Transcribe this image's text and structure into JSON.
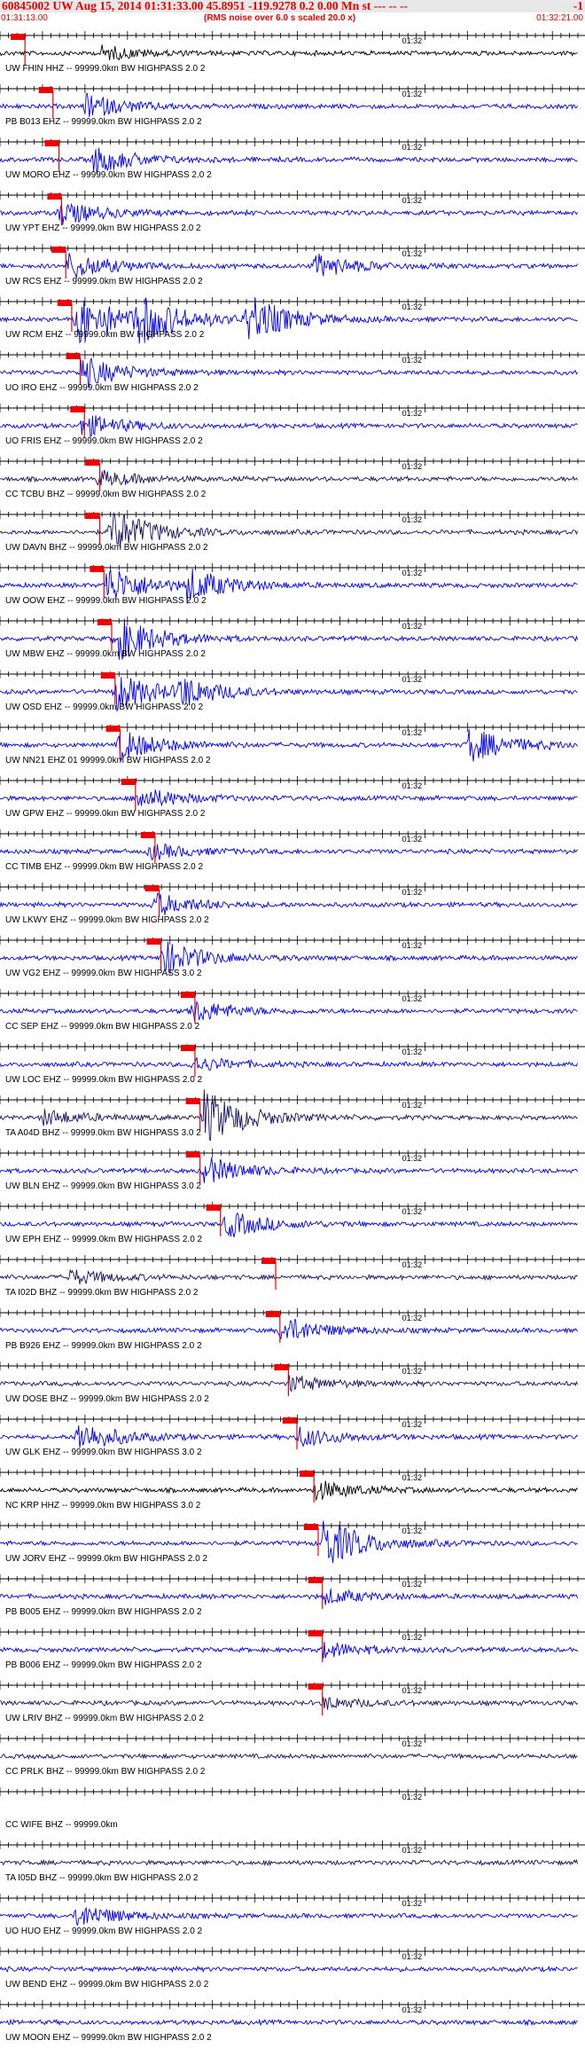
{
  "header": {
    "title": "60845002 UW Aug 15, 2014 01:31:33.00   45.8951 -119.9278  0.2 0.00 Mn st --- -- --",
    "title_tail": "-1",
    "start_time": "01:31:13.00",
    "end_time": "01:32:21.00",
    "rms_note": "(RMS noise over 6.0 s scaled 20.0 x)"
  },
  "colors": {
    "trace_blue": "#0000ee",
    "trace_navy": "#1a1060",
    "trace_black": "#000000",
    "pick_red": "#ee0000",
    "axis": "#000000"
  },
  "chart_data": {
    "type": "seismogram",
    "x_unit": "time",
    "time_start": "01:31:13.00",
    "time_end": "01:32:21.00",
    "minute_mark_label": "01:32",
    "minute_mark_time": "01:32:00",
    "tick_interval_s": 1,
    "traces": [
      {
        "label": "UW FHIN HHZ -- 99999.0km BW  HIGHPASS  2.0  2",
        "color": "black",
        "pick_s": 2.0,
        "events": [
          {
            "t": 12,
            "amp": 0.35
          }
        ]
      },
      {
        "label": "PB B013 EHZ -- 99999.0km BW  HIGHPASS  2.0  2",
        "color": "blue",
        "pick_s": 5.3,
        "events": [
          {
            "t": 10,
            "amp": 0.6
          }
        ]
      },
      {
        "label": "UW MORO EHZ -- 99999.0km BW  HIGHPASS  2.0  2",
        "color": "blue",
        "pick_s": 6.0,
        "events": [
          {
            "t": 11,
            "amp": 0.7
          }
        ]
      },
      {
        "label": "UW YPT EHZ -- 99999.0km BW  HIGHPASS  2.0  2",
        "color": "blue",
        "pick_s": 6.3,
        "events": [
          {
            "t": 7,
            "amp": 0.6
          }
        ]
      },
      {
        "label": "UW RCS EHZ -- 99999.0km BW  HIGHPASS  2.0  2",
        "color": "blue",
        "pick_s": 6.8,
        "events": [
          {
            "t": 8,
            "amp": 0.7
          },
          {
            "t": 37,
            "amp": 0.6
          }
        ]
      },
      {
        "label": "UW RCM EHZ -- 99999.0km BW  HIGHPASS  2.0  2",
        "color": "blue",
        "pick_s": 7.5,
        "events": [
          {
            "t": 9,
            "amp": 1.4
          },
          {
            "t": 16,
            "amp": 1.2
          },
          {
            "t": 29,
            "amp": 1.2
          }
        ]
      },
      {
        "label": "UO IRO EHZ -- 99999.0km BW  HIGHPASS  2.0  2",
        "color": "blue",
        "pick_s": 8.5,
        "events": [
          {
            "t": 9.5,
            "amp": 0.8
          }
        ]
      },
      {
        "label": "UO FRIS EHZ -- 99999.0km BW  HIGHPASS  2.0  2",
        "color": "blue",
        "pick_s": 9.0,
        "events": [
          {
            "t": 9.6,
            "amp": 0.6
          }
        ]
      },
      {
        "label": "CC TCBU BHZ -- 99999.0km BW  HIGHPASS  2.0  2",
        "color": "navy",
        "pick_s": 10.8,
        "events": [
          {
            "t": 11.5,
            "amp": 0.4
          }
        ]
      },
      {
        "label": "UW DAVN BHZ -- 99999.0km BW  HIGHPASS  2.0  2",
        "color": "navy",
        "pick_s": 10.8,
        "events": [
          {
            "t": 13,
            "amp": 1.2
          }
        ]
      },
      {
        "label": "UW OOW EHZ -- 99999.0km BW  HIGHPASS  2.0  2",
        "color": "blue",
        "pick_s": 11.3,
        "events": [
          {
            "t": 12.5,
            "amp": 1.0
          },
          {
            "t": 22,
            "amp": 0.8
          }
        ]
      },
      {
        "label": "UW MBW EHZ -- 99999.0km BW  HIGHPASS  2.0  2",
        "color": "blue",
        "pick_s": 12.2,
        "events": [
          {
            "t": 13.5,
            "amp": 1.2
          }
        ]
      },
      {
        "label": "UW OSD EHZ -- 99999.0km BW  HIGHPASS  2.0  2",
        "color": "blue",
        "pick_s": 12.6,
        "events": [
          {
            "t": 13.5,
            "amp": 1.0
          },
          {
            "t": 21,
            "amp": 0.7
          }
        ]
      },
      {
        "label": "UW NN21 EHZ 01 99999.0km BW  HIGHPASS  2.0  2",
        "color": "blue",
        "pick_s": 13.2,
        "events": [
          {
            "t": 14,
            "amp": 0.8
          },
          {
            "t": 55,
            "amp": 0.9
          }
        ]
      },
      {
        "label": "UW GPW EHZ -- 99999.0km BW  HIGHPASS  2.0  2",
        "color": "blue",
        "pick_s": 15.0,
        "events": [
          {
            "t": 16,
            "amp": 0.6
          }
        ]
      },
      {
        "label": "CC TIMB EHZ -- 99999.0km BW  HIGHPASS  2.0  2",
        "color": "blue",
        "pick_s": 17.3,
        "events": [
          {
            "t": 17.6,
            "amp": 0.4
          }
        ]
      },
      {
        "label": "UW LKWY EHZ -- 99999.0km BW  HIGHPASS  2.0  2",
        "color": "blue",
        "pick_s": 17.8,
        "events": [
          {
            "t": 18,
            "amp": 0.6
          }
        ]
      },
      {
        "label": "UW VG2 EHZ -- 99999.0km BW  HIGHPASS  3.0  2",
        "color": "blue",
        "pick_s": 18.0,
        "events": [
          {
            "t": 19,
            "amp": 0.9
          }
        ]
      },
      {
        "label": "CC SEP EHZ -- 99999.0km BW  HIGHPASS  2.0  2",
        "color": "blue",
        "pick_s": 22.0,
        "events": [
          {
            "t": 22.5,
            "amp": 0.6
          }
        ]
      },
      {
        "label": "UW LOC EHZ -- 99999.0km BW  HIGHPASS  2.0  2",
        "color": "blue",
        "pick_s": 22.0,
        "events": [
          {
            "t": 22.5,
            "amp": 0.4
          }
        ]
      },
      {
        "label": "TA A04D BHZ -- 99999.0km BW  HIGHPASS  3.0  2",
        "color": "navy",
        "pick_s": 22.6,
        "events": [
          {
            "t": 5,
            "amp": 0.4
          },
          {
            "t": 24,
            "amp": 1.4
          }
        ]
      },
      {
        "label": "UW BLN EHZ -- 99999.0km BW  HIGHPASS  3.0  2",
        "color": "blue",
        "pick_s": 22.6,
        "events": [
          {
            "t": 24,
            "amp": 0.7
          }
        ]
      },
      {
        "label": "UW EPH EHZ -- 99999.0km BW  HIGHPASS  2.0  2",
        "color": "blue",
        "pick_s": 25.0,
        "events": [
          {
            "t": 26.5,
            "amp": 0.7
          }
        ]
      },
      {
        "label": "TA I02D BHZ -- 99999.0km BW  HIGHPASS  2.0  2",
        "color": "navy",
        "pick_s": 31.5,
        "events": [
          {
            "t": 8,
            "amp": 0.4
          }
        ]
      },
      {
        "label": "PB B926 EHZ -- 99999.0km BW  HIGHPASS  2.0  2",
        "color": "blue",
        "pick_s": 32.0,
        "events": [
          {
            "t": 33,
            "amp": 0.7
          }
        ]
      },
      {
        "label": "UW DOSE BHZ -- 99999.0km BW  HIGHPASS  2.0  2",
        "color": "navy",
        "pick_s": 33.0,
        "events": [
          {
            "t": 34,
            "amp": 0.4
          }
        ]
      },
      {
        "label": "UW GLK EHZ -- 99999.0km BW  HIGHPASS  3.0  2",
        "color": "blue",
        "pick_s": 34.0,
        "events": [
          {
            "t": 9,
            "amp": 0.8
          },
          {
            "t": 35,
            "amp": 0.5
          }
        ]
      },
      {
        "label": "NC KRP HHZ -- 99999.0km BW  HIGHPASS  3.0  2",
        "color": "black",
        "pick_s": 36.0,
        "events": [
          {
            "t": 37,
            "amp": 0.5
          }
        ]
      },
      {
        "label": "UW JORV EHZ -- 99999.0km BW  HIGHPASS  2.0  2",
        "color": "blue",
        "pick_s": 36.5,
        "events": [
          {
            "t": 38,
            "amp": 1.3
          }
        ]
      },
      {
        "label": "PB B005 EHZ -- 99999.0km BW  HIGHPASS  2.0  2",
        "color": "blue",
        "pick_s": 37.0,
        "events": [
          {
            "t": 38,
            "amp": 0.4
          }
        ]
      },
      {
        "label": "PB B006 EHZ -- 99999.0km BW  HIGHPASS  2.0  2",
        "color": "blue",
        "pick_s": 37.0,
        "events": [
          {
            "t": 38,
            "amp": 0.4
          }
        ]
      },
      {
        "label": "UW LRIV BHZ -- 99999.0km BW  HIGHPASS  2.0  2",
        "color": "navy",
        "pick_s": 37.0,
        "events": [
          {
            "t": 38,
            "amp": 0.3
          }
        ]
      },
      {
        "label": "CC PRLK BHZ -- 99999.0km BW  HIGHPASS  2.0  2",
        "color": "navy",
        "pick_s": null,
        "events": []
      },
      {
        "label": "CC WIFE BHZ -- 99999.0km",
        "color": "none",
        "pick_s": null,
        "events": []
      },
      {
        "label": "TA I05D BHZ -- 99999.0km BW  HIGHPASS  2.0  2",
        "color": "navy",
        "pick_s": null,
        "events": []
      },
      {
        "label": "UO HUO EHZ -- 99999.0km BW  HIGHPASS  2.0  2",
        "color": "blue",
        "pick_s": null,
        "events": [
          {
            "t": 9,
            "amp": 0.6
          }
        ]
      },
      {
        "label": "UW BEND EHZ -- 99999.0km BW  HIGHPASS  2.0  2",
        "color": "blue",
        "pick_s": null,
        "events": []
      },
      {
        "label": "UW MOON EHZ -- 99999.0km BW  HIGHPASS  2.0  2",
        "color": "blue",
        "pick_s": null,
        "events": []
      }
    ]
  }
}
